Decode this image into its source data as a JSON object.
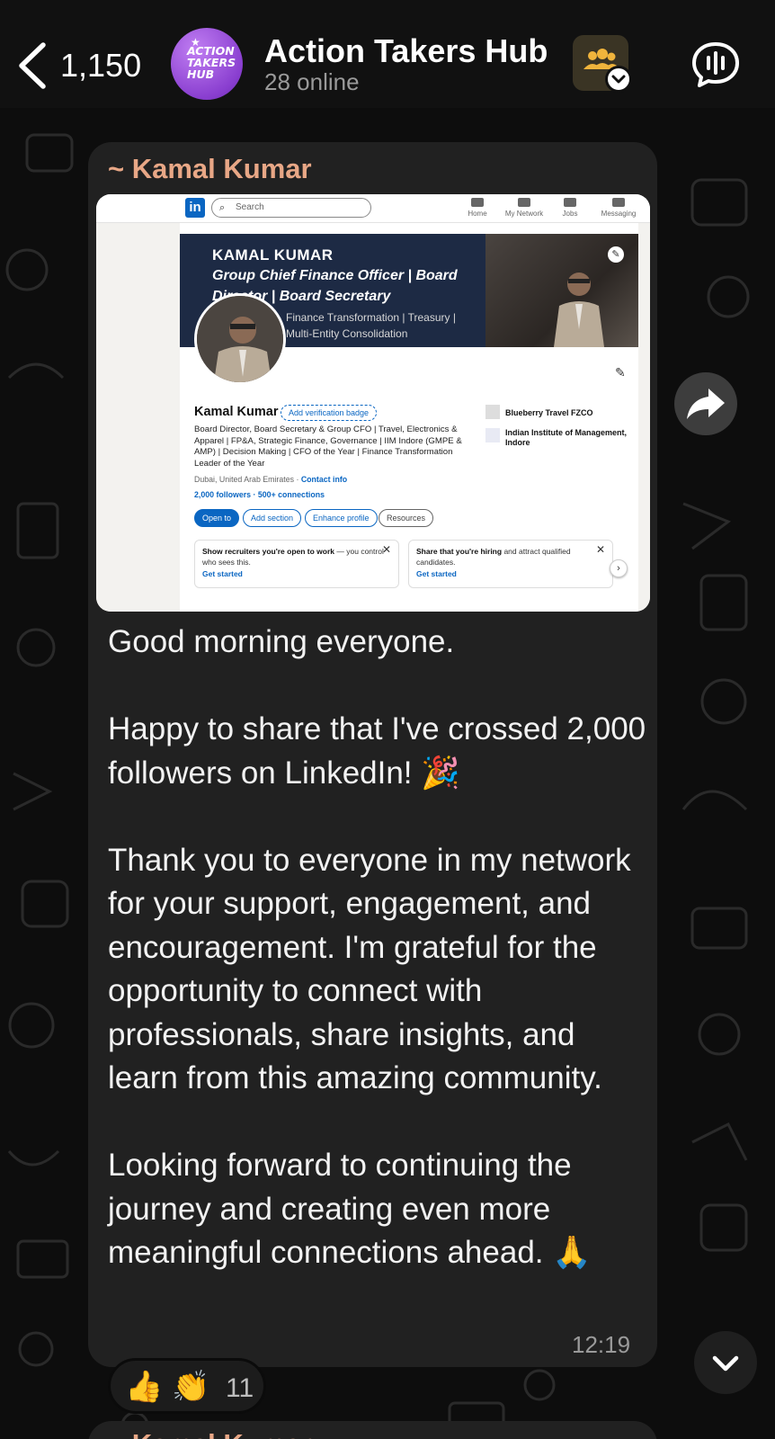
{
  "header": {
    "back_count": "1,150",
    "group_name": "Action Takers Hub",
    "online_status": "28 online",
    "avatar_text": [
      "ACTION",
      "TAKERS",
      "HUB"
    ],
    "icons": {
      "back": "chevron-left-icon",
      "community": "community-people-icon",
      "call": "voice-chat-icon"
    }
  },
  "message": {
    "sender": "~ Kamal Kumar",
    "text": "Good morning everyone.\n\nHappy to share that I've crossed 2,000 followers on LinkedIn! 🎉\n\nThank you to everyone in my network for your support, engagement, and encouragement. I'm grateful for the opportunity to connect with professionals, share insights, and learn from this amazing community.\n\nLooking forward to continuing the journey and creating even more meaningful connections ahead. 🙏",
    "time": "12:19",
    "reactions": {
      "emojis": [
        "👍",
        "👏"
      ],
      "count": "11"
    },
    "image": {
      "search_placeholder": "Search",
      "nav": [
        "Home",
        "My Network",
        "Jobs",
        "Messaging"
      ],
      "banner": {
        "line1": "KAMAL KUMAR",
        "line2": "Group Chief Finance Officer | Board",
        "line3": "Director | Board Secretary",
        "line4": "Finance Transformation | Treasury |",
        "line5": "Multi-Entity Consolidation"
      },
      "name": "Kamal Kumar",
      "badge": "Add verification badge",
      "headline": "Board Director, Board Secretary & Group CFO | Travel, Electronics & Apparel | FP&A, Strategic Finance, Governance | IIM Indore (GMPE & AMP) | Decision Making | CFO of the Year | Finance Transformation Leader of the Year",
      "location": "Dubai, United Arab Emirates",
      "contact": "Contact info",
      "followers": "2,000 followers · 500+ connections",
      "buttons": [
        "Open to",
        "Add section",
        "Enhance profile",
        "Resources"
      ],
      "orgs": [
        "Blueberry Travel FZCO",
        "Indian Institute of Management, Indore"
      ],
      "suggest1": {
        "bold": "Show recruiters you're open to work",
        "rest": " — you control who sees this.",
        "link": "Get started"
      },
      "suggest2": {
        "bold": "Share that you're hiring",
        "rest": " and attract qualified candidates.",
        "link": "Get started"
      }
    }
  },
  "next_message": {
    "sender": "~ Kamal Kumar"
  },
  "colors": {
    "header_bg": "#111111",
    "bubble_bg": "#212121",
    "sender_color": "#e8a786",
    "linkedin_blue": "#0a66c2"
  }
}
